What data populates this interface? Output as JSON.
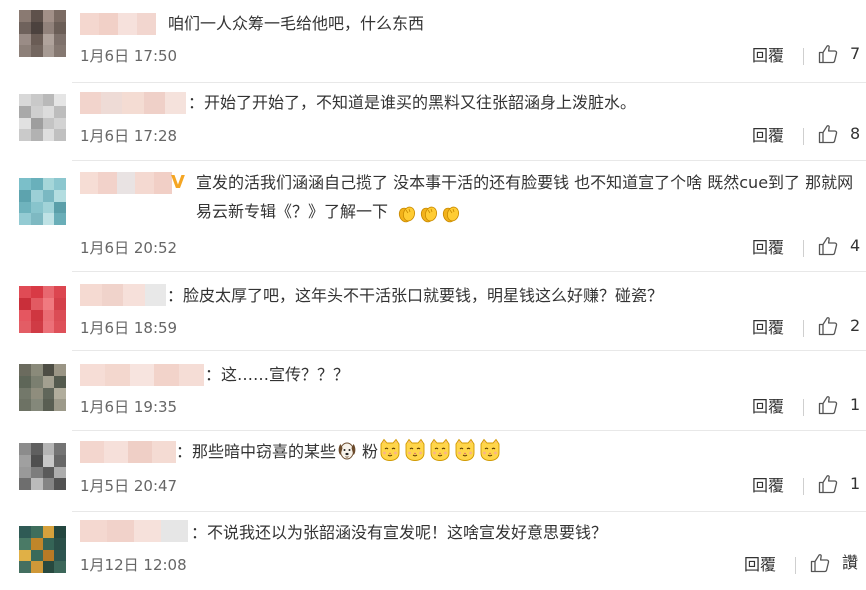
{
  "comments": [
    {
      "text": "咱们一人众筹一毛给他吧，什么东西",
      "time": "1月6日 17:50",
      "reply_label": "回覆",
      "likes": "7",
      "avatar_colors": [
        "#8a7a72",
        "#5e514b",
        "#a29088",
        "#7b6b63",
        "#6f625c",
        "#4c423e",
        "#91827b",
        "#6b5e57",
        "#9a8c86",
        "#6a5c55",
        "#b0a39c",
        "#7e716b",
        "#8d8079",
        "#73665f",
        "#a79b94",
        "#857871"
      ],
      "name_colors": [
        "#f4d7cf",
        "#f1d0c7",
        "#f6e1dc",
        "#f2d6cf"
      ]
    },
    {
      "text": "：开始了开始了，不知道是谁买的黑料又往张韶涵身上泼脏水。",
      "time": "1月6日 17:28",
      "reply_label": "回覆",
      "likes": "8",
      "avatar_colors": [
        "#d8d8d8",
        "#c9c9c9",
        "#b9b9b9",
        "#e5e5e5",
        "#a9a9a9",
        "#cfcfcf",
        "#dcdcdc",
        "#bdbdbd",
        "#e1e1e1",
        "#9e9e9e",
        "#c4c4c4",
        "#d3d3d3",
        "#cacaca",
        "#b2b2b2",
        "#dedede",
        "#c0c0c0"
      ],
      "name_colors": [
        "#f2d4cc",
        "#eedbd6",
        "#f4dcd3",
        "#efd0c8",
        "#f5e2dc"
      ]
    },
    {
      "text": "宣发的活我们涵涵自己揽了 没本事干活的还有脸要钱 也不知道宣了个啥 既然cue到了 那就网易云新专辑《？》了解一下",
      "time": "1月6日 20:52",
      "reply_label": "回覆",
      "likes": "4",
      "avatar_colors": [
        "#7bbfc9",
        "#69b0bb",
        "#a5d6d9",
        "#8cc7cf",
        "#5da3ae",
        "#9ccfd6",
        "#7ab8c2",
        "#b3dde0",
        "#6fb3bd",
        "#88c4cc",
        "#a1d3d8",
        "#5b9fa9",
        "#94cbd3",
        "#7eb9c2",
        "#bfe2e5",
        "#6aaeb8"
      ],
      "name_colors": [
        "#f6ddd5",
        "#f2d2ca",
        "#e9e3e3",
        "#f4d9d1",
        "#f1cfc6"
      ]
    },
    {
      "text": "：脸皮太厚了吧，这年头不干活张口就要钱，明星钱这么好赚？碰瓷？",
      "time": "1月6日 18:59",
      "reply_label": "回覆",
      "likes": "2",
      "avatar_colors": [
        "#e04b55",
        "#d83a45",
        "#e86870",
        "#dc4650",
        "#c92f3a",
        "#e25a62",
        "#f07a80",
        "#d4404a",
        "#e55660",
        "#cf3640",
        "#ea6c73",
        "#db4c55",
        "#e35d65",
        "#d03b45",
        "#ec7078",
        "#de5059"
      ],
      "name_colors": [
        "#f5dad2",
        "#f0d3cb",
        "#f6e0da",
        "#e8e8e8"
      ]
    },
    {
      "text": "：这……宣传？？？",
      "time": "1月6日 19:35",
      "reply_label": "回覆",
      "likes": "1",
      "avatar_colors": [
        "#6b6b5e",
        "#8a8a7a",
        "#4d4d44",
        "#9a9585",
        "#5e6658",
        "#7b7f70",
        "#a3a090",
        "#545a4e",
        "#73786a",
        "#8f8d7d",
        "#60665a",
        "#b1ad9c",
        "#6d7264",
        "#84887a",
        "#595e52",
        "#9d9a8a"
      ],
      "name_colors": [
        "#f6ddd6",
        "#f3d7ce",
        "#f7e4df",
        "#f2d3ca",
        "#f5ddd6"
      ]
    },
    {
      "text": "：那些暗中窃喜的某些",
      "text_suffix": "粉",
      "time": "1月5日 20:47",
      "reply_label": "回覆",
      "likes": "1",
      "avatar_colors": [
        "#8c8c8c",
        "#5f5f5f",
        "#b5b5b5",
        "#747474",
        "#a0a0a0",
        "#4f4f4f",
        "#c8c8c8",
        "#676767",
        "#999999",
        "#7d7d7d",
        "#5a5a5a",
        "#adadad",
        "#6e6e6e",
        "#bbbbbb",
        "#848484",
        "#525252"
      ],
      "name_colors": [
        "#f3d6ce",
        "#f6e0da",
        "#efcfc6",
        "#f4dbd3"
      ]
    },
    {
      "text": "：不说我还以为张韶涵没有宣发呢！这啥宣发好意思要钱？",
      "time": "1月12日 12:08",
      "reply_label": "回覆",
      "likes": "讚",
      "avatar_colors": [
        "#2f5a55",
        "#3f6e5c",
        "#d6a13c",
        "#24463f",
        "#4a7a66",
        "#c0862a",
        "#356456",
        "#2a4f48",
        "#e0b046",
        "#3a6a5a",
        "#b87a25",
        "#2d5550",
        "#446f60",
        "#cf9838",
        "#27493f",
        "#3c675a"
      ],
      "name_colors": [
        "#f4d8d0",
        "#f1d2ca",
        "#f6e1db",
        "#e6e6e6"
      ]
    }
  ],
  "colors": {
    "badge": "#f5a623",
    "divider": "#e8e8e8",
    "meta_text": "#666666"
  },
  "icons": {
    "like": "thumbs-up-outline-icon",
    "verified": "v-badge-icon",
    "clap": "clapping-hands-emoji-icon",
    "cat": "cat-face-emoji-icon",
    "dog": "dog-face-emoji-icon"
  }
}
